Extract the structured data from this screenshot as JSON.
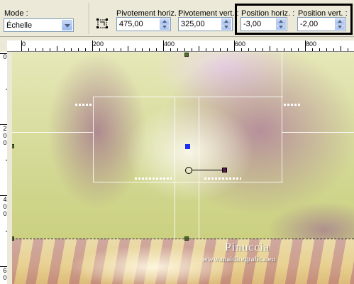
{
  "toolbar": {
    "mode": {
      "label": "Mode :",
      "value": "Échelle"
    },
    "pivot_h": {
      "label": "Pivotement horiz. :",
      "value": "475,00"
    },
    "pivot_v": {
      "label": "Pivotement vert. :",
      "value": "325,00"
    },
    "pos_h": {
      "label": "Position horiz. :",
      "value": "-3,00"
    },
    "pos_v": {
      "label": "Position vert. :",
      "value": "-2,00"
    }
  },
  "ruler_h": {
    "labels": [
      "0",
      "200",
      "400",
      "600",
      "800"
    ]
  },
  "ruler_v": {
    "labels": [
      "0",
      "2 0 0",
      "4 0 0",
      "6 0"
    ]
  },
  "watermark": {
    "name": "Pinuccia",
    "url": "www.maidiregrafica.eu"
  },
  "colors": {
    "selection_box": "#000000",
    "center_handle": "#1a2ef0",
    "toolbar_bg": "#ece9d8"
  }
}
